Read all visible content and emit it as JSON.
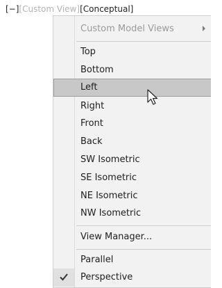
{
  "viewport_label": {
    "seg1": "[−]",
    "seg2": "[Custom View]",
    "seg3": "[Conceptual]"
  },
  "menu": {
    "custom_model_views": "Custom Model Views",
    "items": {
      "top": "Top",
      "bottom": "Bottom",
      "left": "Left",
      "right": "Right",
      "front": "Front",
      "back": "Back",
      "sw_isometric": "SW Isometric",
      "se_isometric": "SE Isometric",
      "ne_isometric": "NE Isometric",
      "nw_isometric": "NW Isometric"
    },
    "view_manager": "View Manager...",
    "parallel": "Parallel",
    "perspective": "Perspective"
  },
  "icons": {
    "submenu": "chevron-right-icon",
    "checked": "checkmark-icon",
    "cursor": "arrow-cursor-icon"
  },
  "colors": {
    "highlight": "#c8c8c8",
    "menu_bg": "#f2f2f2",
    "disabled_text": "#9a9a9a",
    "dim_label": "#b4b4b4"
  }
}
